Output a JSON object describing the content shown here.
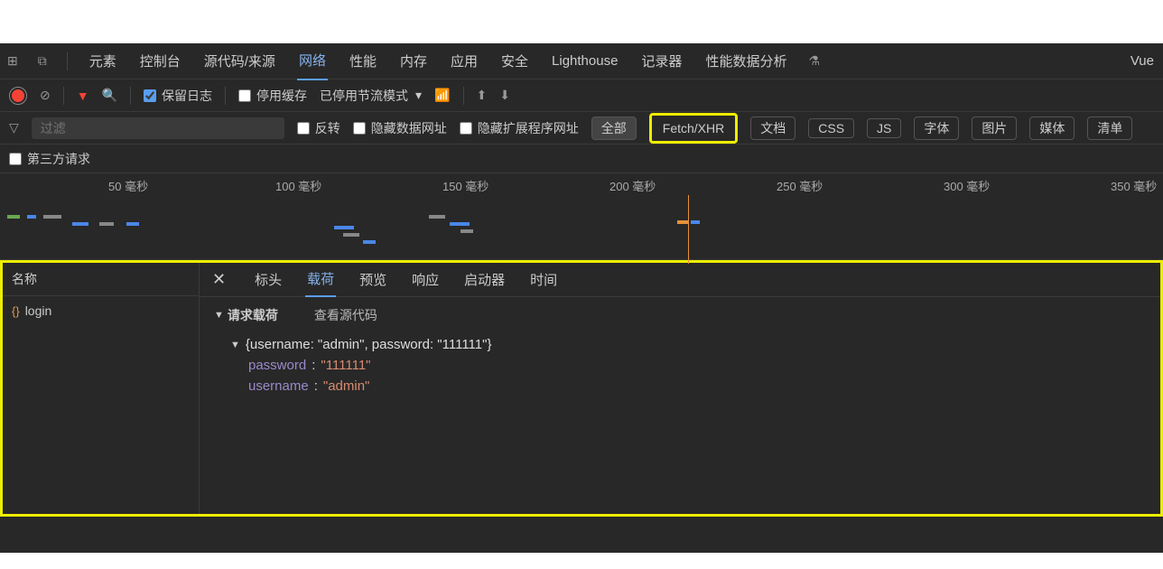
{
  "tabs": {
    "elements": "元素",
    "console": "控制台",
    "sources": "源代码/来源",
    "network": "网络",
    "performance": "性能",
    "memory": "内存",
    "application": "应用",
    "security": "安全",
    "lighthouse": "Lighthouse",
    "recorder": "记录器",
    "perf_insights": "性能数据分析",
    "vue": "Vue"
  },
  "toolbar": {
    "preserve_log": "保留日志",
    "disable_cache": "停用缓存",
    "throttling": "已停用节流模式"
  },
  "filter": {
    "placeholder": "过滤",
    "invert": "反转",
    "hide_data_urls": "隐藏数据网址",
    "hide_ext_urls": "隐藏扩展程序网址",
    "chips": {
      "all": "全部",
      "fetch_xhr": "Fetch/XHR",
      "doc": "文档",
      "css": "CSS",
      "js": "JS",
      "font": "字体",
      "img": "图片",
      "media": "媒体",
      "manifest": "清单"
    },
    "third_party": "第三方请求"
  },
  "timeline": {
    "marks": [
      "50 毫秒",
      "100 毫秒",
      "150 毫秒",
      "200 毫秒",
      "250 毫秒",
      "300 毫秒",
      "350 毫秒"
    ]
  },
  "requests": {
    "header": "名称",
    "items": [
      "login"
    ]
  },
  "detail": {
    "tabs": {
      "headers": "标头",
      "payload": "载荷",
      "preview": "预览",
      "response": "响应",
      "initiator": "启动器",
      "timing": "时间"
    },
    "payload": {
      "title": "请求载荷",
      "view_source": "查看源代码",
      "summary": "{username: \"admin\", password: \"111111\"}",
      "fields": [
        {
          "key": "password",
          "value": "\"111111\""
        },
        {
          "key": "username",
          "value": "\"admin\""
        }
      ]
    }
  }
}
